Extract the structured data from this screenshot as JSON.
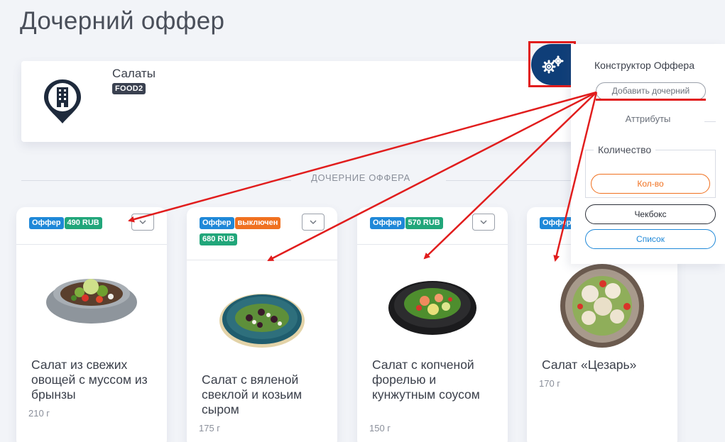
{
  "page": {
    "title": "Дочерний оффер"
  },
  "parent": {
    "name": "Салаты",
    "code": "FOOD2"
  },
  "section_label": "ДОЧЕРНИЕ ОФФЕРА",
  "cards": [
    {
      "badges": [
        "Оффер",
        "490 RUB"
      ],
      "name": "Салат из свежих овощей с муссом из брынзы",
      "weight": "210 г"
    },
    {
      "badges": [
        "Оффер",
        "выключен",
        "680 RUB"
      ],
      "name": "Салат с вяленой свеклой и козьим сыром",
      "weight": "175 г"
    },
    {
      "badges": [
        "Оффер",
        "570 RUB"
      ],
      "name": "Салат с копченой форелью и кунжутным соусом",
      "weight": "150 г"
    },
    {
      "badges": [
        "Оффер"
      ],
      "name": "Салат «Цезарь»",
      "weight": "170 г"
    }
  ],
  "panel": {
    "title": "Конструктор Оффера",
    "add_child": "Добавить дочерний",
    "attributes": "Аттрибуты",
    "quantity_legend": "Количество",
    "quantity_button": "Кол-во",
    "checkbox_button": "Чекбокс",
    "list_button": "Список"
  },
  "icons": {
    "parent": "building-pin-icon",
    "settings": "gears-icon",
    "dropdown": "chevron-down-icon"
  },
  "colors": {
    "primary": "#0f3e78",
    "badge_offer": "#1f88d8",
    "badge_price": "#21a67a",
    "badge_disabled": "#f07120",
    "annotation": "#e11d1d"
  }
}
